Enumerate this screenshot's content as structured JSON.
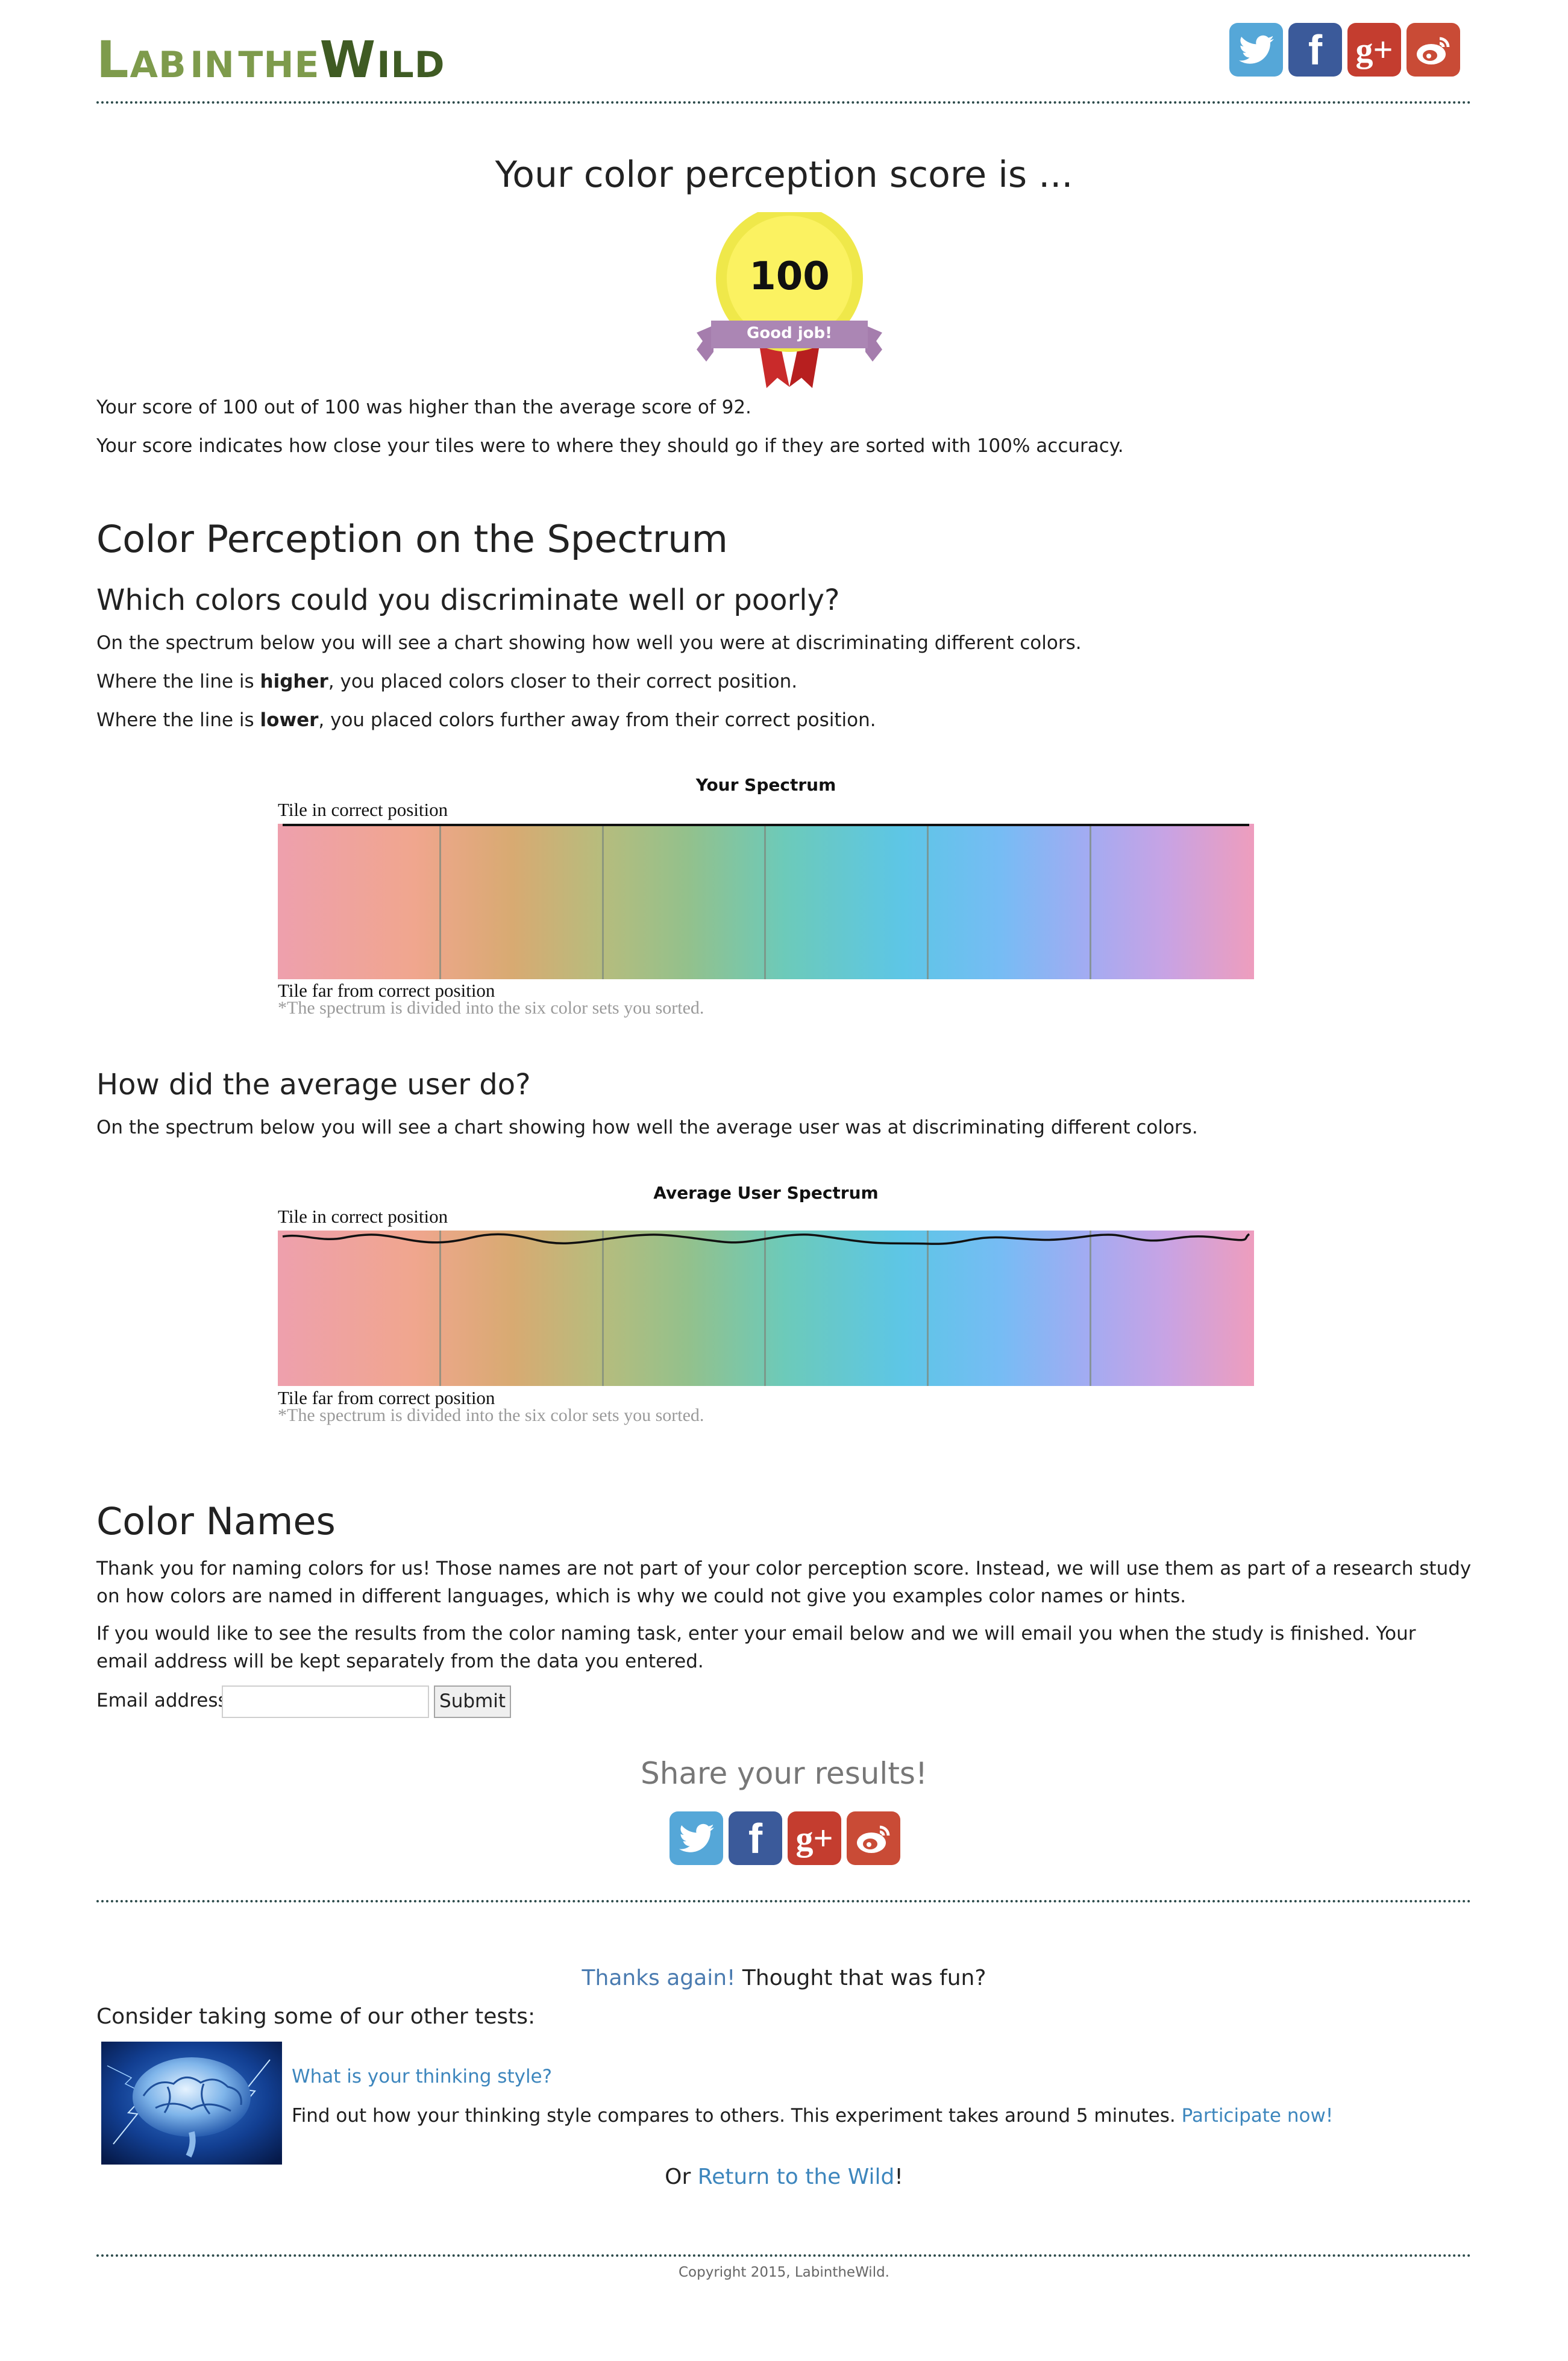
{
  "header": {
    "logo_parts": [
      "L",
      "AB",
      "IN",
      "THE",
      "W",
      "ILD"
    ]
  },
  "social_icons": [
    "twitter-icon",
    "facebook-icon",
    "google-plus-icon",
    "weibo-icon"
  ],
  "score": {
    "title": "Your color perception score is ...",
    "value": "100",
    "ribbon": "Good job!",
    "line1": "Your score of 100 out of 100 was higher than the average score of 92.",
    "line2": "Your score indicates how close your tiles were to where they should go if they are sorted with 100% accuracy."
  },
  "spectrum_section": {
    "heading": "Color Perception on the Spectrum",
    "subheading": "Which colors could you discriminate well or poorly?",
    "p1": "On the spectrum below you will see a chart showing how well you were at discriminating different colors.",
    "p2_pre": "Where the line is ",
    "p2_bold": "higher",
    "p2_post": ", you placed colors closer to their correct position.",
    "p3_pre": "Where the line is ",
    "p3_bold": "lower",
    "p3_post": ", you placed colors further away from their correct position."
  },
  "your_chart": {
    "title": "Your Spectrum",
    "top_label": "Tile in correct position",
    "bottom_label": "Tile far from correct position",
    "note": "*The spectrum is divided into the six color sets you sorted."
  },
  "average_section": {
    "heading": "How did the average user do?",
    "p1": "On the spectrum below you will see a chart showing how well the average user was at discriminating different colors."
  },
  "avg_chart": {
    "title": "Average User Spectrum",
    "top_label": "Tile in correct position",
    "bottom_label": "Tile far from correct position",
    "note": "*The spectrum is divided into the six color sets you sorted."
  },
  "color_names": {
    "heading": "Color Names",
    "p1": "Thank you for naming colors for us! Those names are not part of your color perception score. Instead, we will use them as part of a research study on how colors are named in different languages, which is why we could not give you examples color names or hints.",
    "p2": "If you would like to see the results from the color naming task, enter your email below and we will email you when the study is finished. Your email address will be kept separately from the data you entered.",
    "email_label": "Email address:",
    "email_value": "",
    "submit_label": "Submit"
  },
  "share": {
    "title": "Share your results!"
  },
  "footer": {
    "thanks_link": "Thanks again!",
    "thanks_text": " Thought that was fun?",
    "consider": "Consider taking some of our other tests:",
    "test_title": "What is your thinking style?",
    "test_desc": "Find out how your thinking style compares to others. This experiment takes around 5 minutes. ",
    "test_cta": "Participate now!",
    "or_text": "Or ",
    "return_link": "Return to the Wild",
    "return_end": "!",
    "copyright": "Copyright 2015, LabintheWild."
  }
}
